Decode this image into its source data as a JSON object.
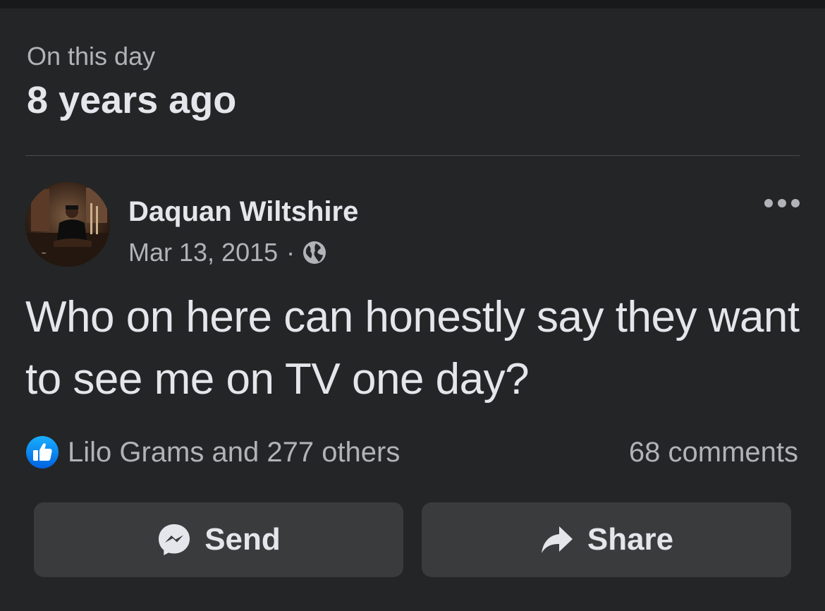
{
  "memory": {
    "subtitle": "On this day",
    "title": "8 years ago"
  },
  "post": {
    "author": "Daquan Wiltshire",
    "date": "Mar 13, 2015",
    "separator": "·",
    "audience_icon": "globe-icon",
    "text": "Who on here can honestly say they want to see me on TV one day?"
  },
  "engagement": {
    "reactions_text": "Lilo Grams and 277 others",
    "reaction_icon": "like-icon",
    "comments_text": "68 comments"
  },
  "actions": {
    "send_label": "Send",
    "share_label": "Share"
  },
  "colors": {
    "background": "#242526",
    "button_bg": "#3a3b3c",
    "primary_text": "#e4e6eb",
    "secondary_text": "#b0b3b8",
    "like_blue": "#1877f2"
  }
}
